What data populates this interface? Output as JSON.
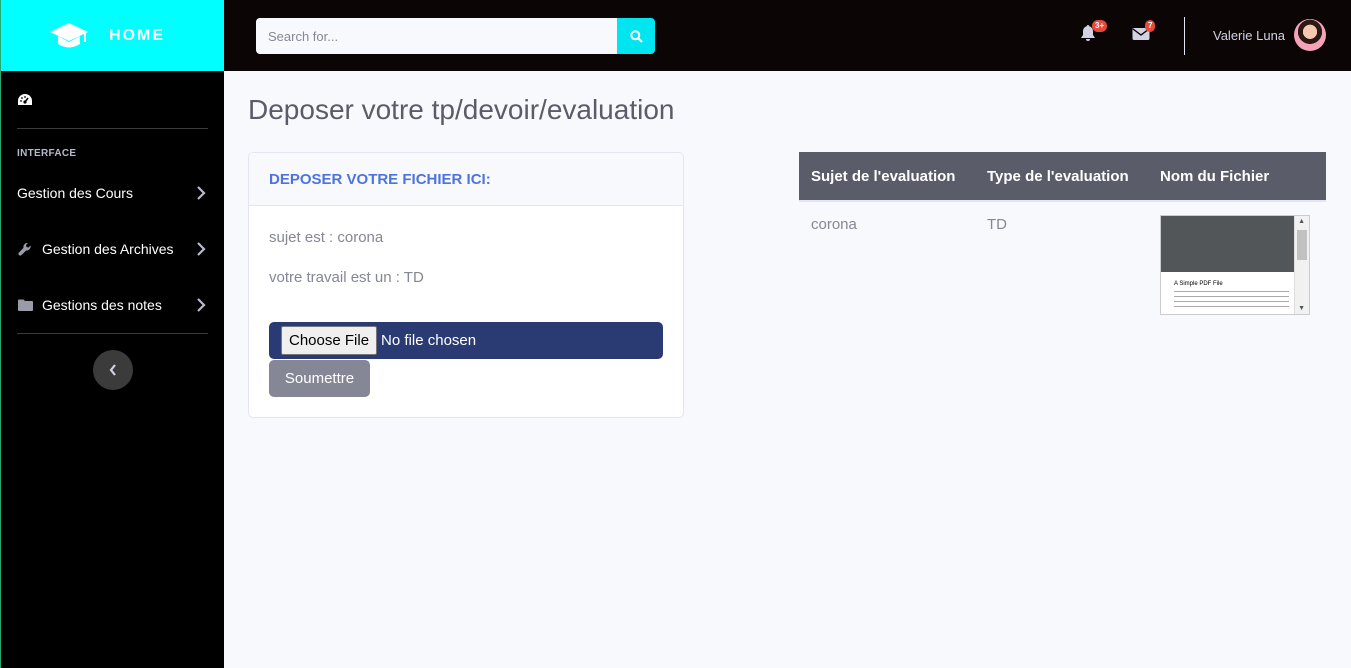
{
  "brand": {
    "title": "HOME",
    "icon": "graduation-cap-icon",
    "color": "#00ffff"
  },
  "sidebar": {
    "dashboard_icon": "tachometer-icon",
    "section_heading": "INTERFACE",
    "items": [
      {
        "label": "Gestion des Cours",
        "icon": ""
      },
      {
        "label": "Gestion des Archives",
        "icon": "wrench-icon"
      },
      {
        "label": "Gestions des notes",
        "icon": "folder-icon"
      }
    ],
    "toggle_icon": "chevron-left-icon"
  },
  "topbar": {
    "search": {
      "placeholder": "Search for...",
      "value": ""
    },
    "alerts": {
      "icon": "bell-icon",
      "count": "3+"
    },
    "messages": {
      "icon": "envelope-icon",
      "count": "7"
    },
    "user": {
      "name": "Valerie Luna"
    },
    "accent_color": "#00e5f0"
  },
  "page": {
    "title": "Deposer votre tp/devoir/evaluation"
  },
  "upload_card": {
    "header": "DEPOSER VOTRE FICHIER ICI:",
    "subject_line": "sujet est : corona",
    "type_line": "votre travail est un : TD",
    "choose_label": "Choose File",
    "file_status": "No file chosen",
    "submit_label": "Soumettre"
  },
  "table": {
    "headers": [
      "Sujet de l'evaluation",
      "Type de l'evaluation",
      "Nom du Fichier"
    ],
    "rows": [
      {
        "sujet": "corona",
        "type": "TD",
        "file_preview_title": "A Simple PDF File"
      }
    ]
  }
}
